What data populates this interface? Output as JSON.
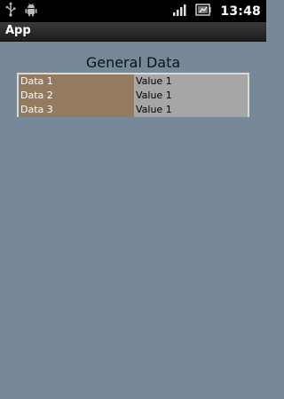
{
  "status_bar": {
    "time": "13:48",
    "left_icons": [
      "usb-icon",
      "android-debug-icon"
    ],
    "right_icons": [
      "signal-icon",
      "battery-icon"
    ]
  },
  "app_bar": {
    "title": "App"
  },
  "content": {
    "heading": "General Data",
    "rows": [
      {
        "label": "Data 1",
        "value": "Value 1"
      },
      {
        "label": "Data 2",
        "value": "Value 1"
      },
      {
        "label": "Data 3",
        "value": "Value 1"
      }
    ]
  },
  "colors": {
    "background": "#778899",
    "label_cell": "#947b5f",
    "value_cell": "#a6a6a6",
    "table_border": "#d9d9d9"
  }
}
